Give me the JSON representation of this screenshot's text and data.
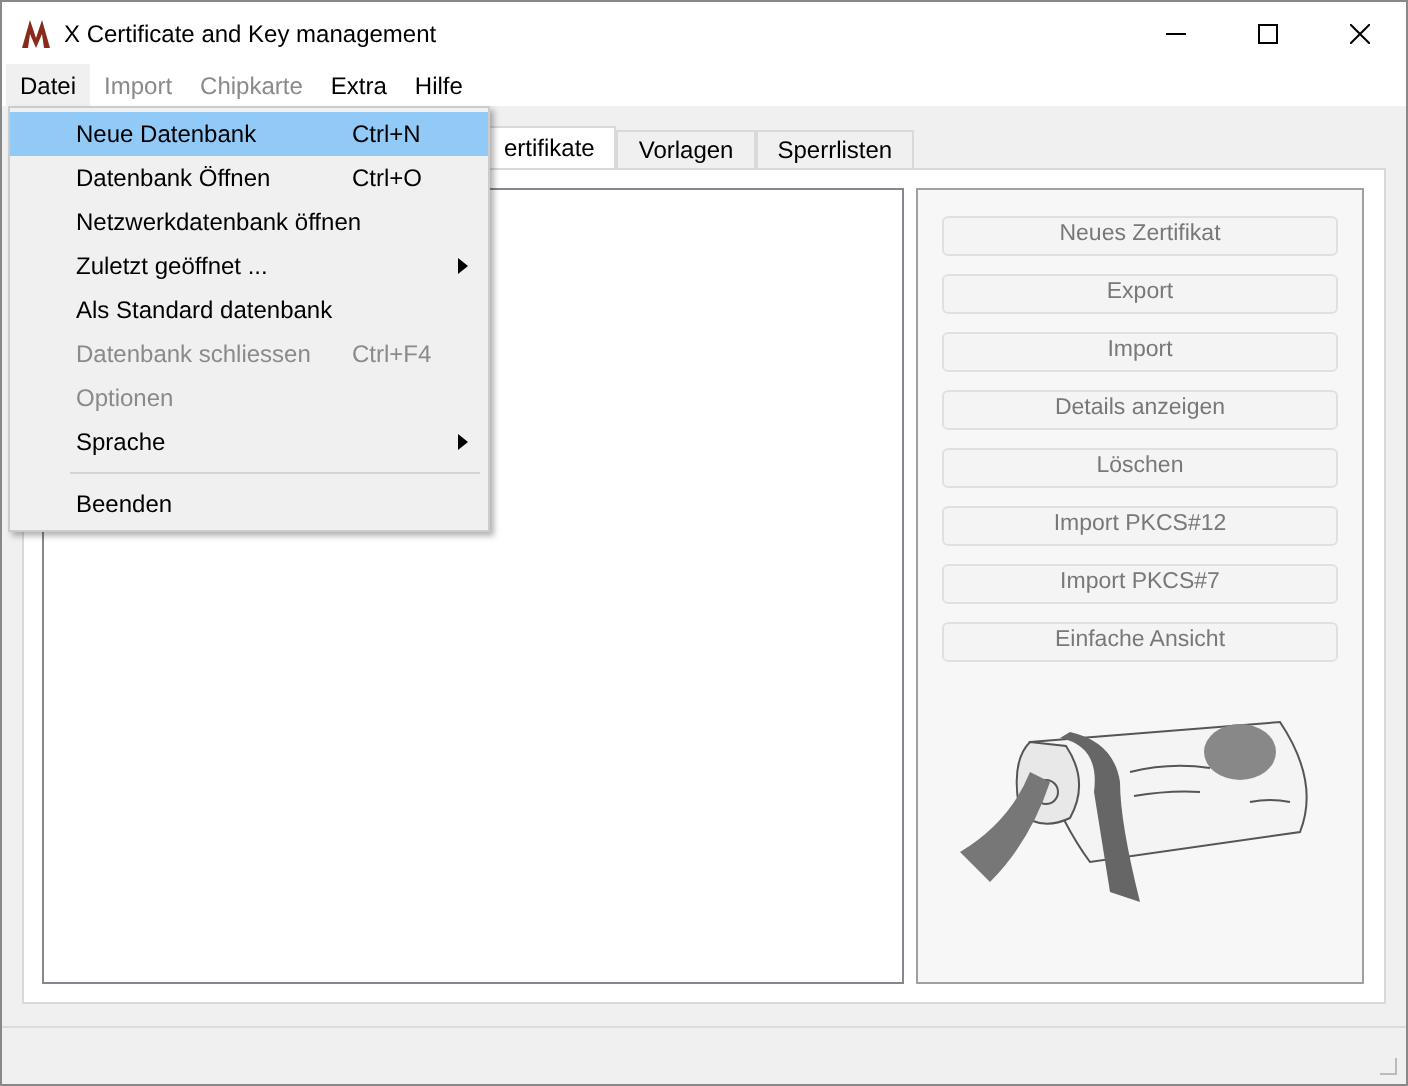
{
  "window": {
    "title": "X Certificate and Key management"
  },
  "menu_bar": [
    {
      "label": "Datei",
      "disabled": false,
      "selected": true
    },
    {
      "label": "Import",
      "disabled": true,
      "selected": false
    },
    {
      "label": "Chipkarte",
      "disabled": true,
      "selected": false
    },
    {
      "label": "Extra",
      "disabled": false,
      "selected": false
    },
    {
      "label": "Hilfe",
      "disabled": false,
      "selected": false
    }
  ],
  "tabs": [
    {
      "label": "ertifikate",
      "selected": true
    },
    {
      "label": "Vorlagen",
      "selected": false
    },
    {
      "label": "Sperrlisten",
      "selected": false
    }
  ],
  "menu": [
    {
      "kind": "item",
      "label": "Neue Datenbank",
      "shortcut": "Ctrl+N",
      "disabled": false,
      "selected": true
    },
    {
      "kind": "item",
      "label": "Datenbank Öffnen",
      "shortcut": "Ctrl+O",
      "disabled": false,
      "selected": false
    },
    {
      "kind": "item",
      "label": "Netzwerkdatenbank öffnen",
      "disabled": false,
      "selected": false
    },
    {
      "kind": "submenu",
      "label": "Zuletzt geöffnet ...",
      "disabled": false,
      "selected": false
    },
    {
      "kind": "item",
      "label": "Als Standard datenbank",
      "disabled": false,
      "selected": false
    },
    {
      "kind": "item",
      "label": "Datenbank schliessen",
      "shortcut": "Ctrl+F4",
      "disabled": true,
      "selected": false
    },
    {
      "kind": "item",
      "label": "Optionen",
      "disabled": true,
      "selected": false
    },
    {
      "kind": "submenu",
      "label": "Sprache",
      "disabled": false,
      "selected": false
    },
    {
      "kind": "separator"
    },
    {
      "kind": "item",
      "label": "Beenden",
      "disabled": false,
      "selected": false
    }
  ],
  "buttons": [
    {
      "label": "Neues Zertifikat",
      "disabled": true
    },
    {
      "label": "Export",
      "disabled": true
    },
    {
      "label": "Import",
      "disabled": true
    },
    {
      "label": "Details anzeigen",
      "disabled": true
    },
    {
      "label": "Löschen",
      "disabled": true
    },
    {
      "label": "Import PKCS#12",
      "disabled": true
    },
    {
      "label": "Import PKCS#7",
      "disabled": true
    },
    {
      "label": "Einfache Ansicht",
      "disabled": true
    }
  ]
}
